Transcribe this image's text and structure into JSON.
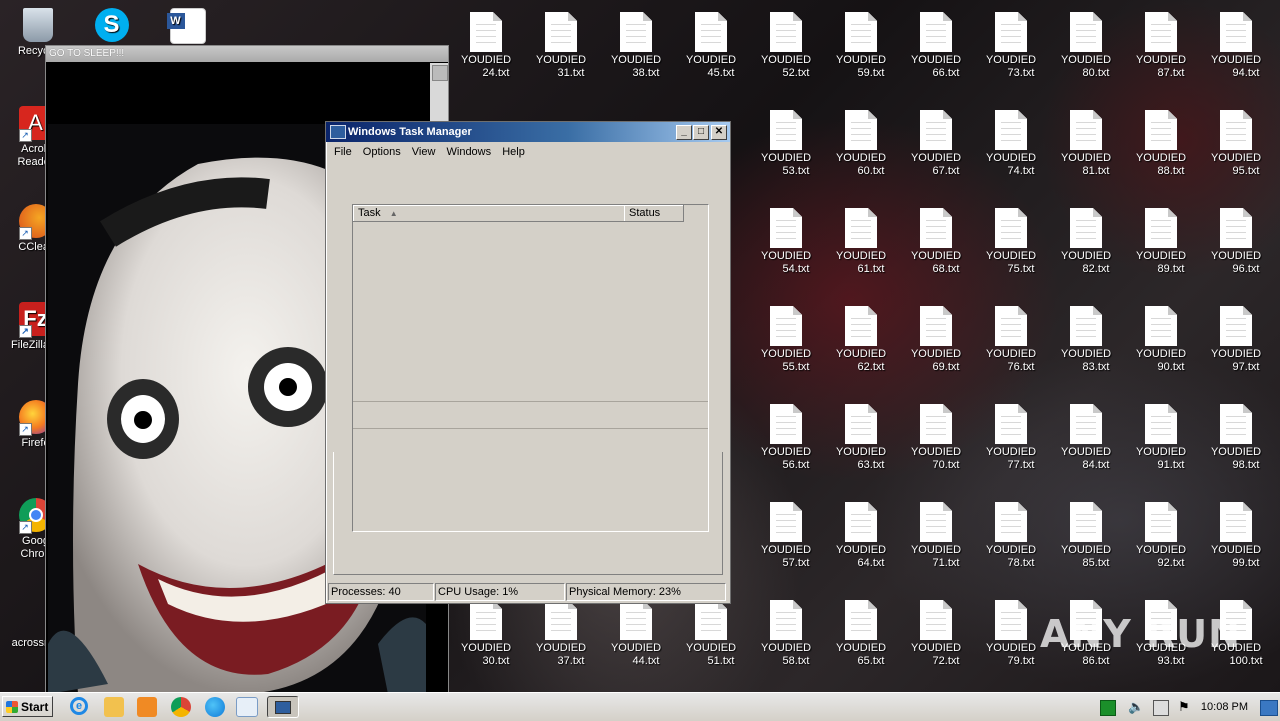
{
  "desktop_shortcuts": [
    {
      "label": "Recycle",
      "icon": "recycle-bin-icon",
      "color": "#9aa9b8"
    },
    {
      "label": "Acrob\nReader",
      "icon": "acrobat-icon",
      "color": "#d7261e"
    },
    {
      "label": "CClear",
      "icon": "ccleaner-icon",
      "color": "#e05a1b"
    },
    {
      "label": "FileZilla C",
      "icon": "filezilla-icon",
      "color": "#c8201d"
    },
    {
      "label": "Firefo",
      "icon": "firefox-icon",
      "color": "#f47b20"
    },
    {
      "label": "Goog\nChron",
      "icon": "chrome-icon",
      "color": "#34a853"
    },
    {
      "label": "acrossma",
      "icon": "file-icon",
      "color": "#ffffff"
    }
  ],
  "top_icons": [
    {
      "label": "",
      "icon": "skype-icon",
      "color": "#00aff0"
    },
    {
      "label": "",
      "icon": "word-icon",
      "color": "#2b579a"
    }
  ],
  "files": [
    {
      "line1": "YOUDIED",
      "line2": "24.txt"
    },
    {
      "line1": "YOUDIED",
      "line2": "31.txt"
    },
    {
      "line1": "YOUDIED",
      "line2": "38.txt"
    },
    {
      "line1": "YOUDIED",
      "line2": "45.txt"
    },
    {
      "line1": "YOUDIED",
      "line2": "52.txt"
    },
    {
      "line1": "YOUDIED",
      "line2": "59.txt"
    },
    {
      "line1": "YOUDIED",
      "line2": "66.txt"
    },
    {
      "line1": "YOUDIED",
      "line2": "73.txt"
    },
    {
      "line1": "YOUDIED",
      "line2": "80.txt"
    },
    {
      "line1": "YOUDIED",
      "line2": "87.txt"
    },
    {
      "line1": "YOUDIED",
      "line2": "94.txt"
    },
    {
      "line1": "YOUDIED",
      "line2": "53.txt"
    },
    {
      "line1": "YOUDIED",
      "line2": "60.txt"
    },
    {
      "line1": "YOUDIED",
      "line2": "67.txt"
    },
    {
      "line1": "YOUDIED",
      "line2": "74.txt"
    },
    {
      "line1": "YOUDIED",
      "line2": "81.txt"
    },
    {
      "line1": "YOUDIED",
      "line2": "88.txt"
    },
    {
      "line1": "YOUDIED",
      "line2": "95.txt"
    },
    {
      "line1": "YOUDIED",
      "line2": "54.txt"
    },
    {
      "line1": "YOUDIED",
      "line2": "61.txt"
    },
    {
      "line1": "YOUDIED",
      "line2": "68.txt"
    },
    {
      "line1": "YOUDIED",
      "line2": "75.txt"
    },
    {
      "line1": "YOUDIED",
      "line2": "82.txt"
    },
    {
      "line1": "YOUDIED",
      "line2": "89.txt"
    },
    {
      "line1": "YOUDIED",
      "line2": "96.txt"
    },
    {
      "line1": "YOUDIED",
      "line2": "55.txt"
    },
    {
      "line1": "YOUDIED",
      "line2": "62.txt"
    },
    {
      "line1": "YOUDIED",
      "line2": "69.txt"
    },
    {
      "line1": "YOUDIED",
      "line2": "76.txt"
    },
    {
      "line1": "YOUDIED",
      "line2": "83.txt"
    },
    {
      "line1": "YOUDIED",
      "line2": "90.txt"
    },
    {
      "line1": "YOUDIED",
      "line2": "97.txt"
    },
    {
      "line1": "YOUDIED",
      "line2": "56.txt"
    },
    {
      "line1": "YOUDIED",
      "line2": "63.txt"
    },
    {
      "line1": "YOUDIED",
      "line2": "70.txt"
    },
    {
      "line1": "YOUDIED",
      "line2": "77.txt"
    },
    {
      "line1": "YOUDIED",
      "line2": "84.txt"
    },
    {
      "line1": "YOUDIED",
      "line2": "91.txt"
    },
    {
      "line1": "YOUDIED",
      "line2": "98.txt"
    },
    {
      "line1": "YOUDIED",
      "line2": "57.txt"
    },
    {
      "line1": "YOUDIED",
      "line2": "64.txt"
    },
    {
      "line1": "YOUDIED",
      "line2": "71.txt"
    },
    {
      "line1": "YOUDIED",
      "line2": "78.txt"
    },
    {
      "line1": "YOUDIED",
      "line2": "85.txt"
    },
    {
      "line1": "YOUDIED",
      "line2": "92.txt"
    },
    {
      "line1": "YOUDIED",
      "line2": "99.txt"
    },
    {
      "line1": "YOUDIED",
      "line2": "30.txt"
    },
    {
      "line1": "YOUDIED",
      "line2": "37.txt"
    },
    {
      "line1": "YOUDIED",
      "line2": "44.txt"
    },
    {
      "line1": "YOUDIED",
      "line2": "51.txt"
    },
    {
      "line1": "YOUDIED",
      "line2": "58.txt"
    },
    {
      "line1": "YOUDIED",
      "line2": "65.txt"
    },
    {
      "line1": "YOUDIED",
      "line2": "72.txt"
    },
    {
      "line1": "YOUDIED",
      "line2": "79.txt"
    },
    {
      "line1": "YOUDIED",
      "line2": "86.txt"
    },
    {
      "line1": "YOUDIED",
      "line2": "93.txt"
    },
    {
      "line1": "YOUDIED",
      "line2": "100.txt"
    }
  ],
  "horror_window": {
    "title": "GO TO SLEEP!!!"
  },
  "task_manager": {
    "title": "Windows Task Manager",
    "menu": [
      "File",
      "Options",
      "View",
      "Windows",
      "Help"
    ],
    "columns": {
      "task": "Task",
      "status": "Status"
    },
    "status_bar": {
      "processes": "Processes: 40",
      "cpu": "CPU Usage: 1%",
      "memory": "Physical Memory: 23%"
    },
    "controls": {
      "minimize": "_",
      "maximize": "□",
      "close": "✕"
    }
  },
  "taskbar": {
    "start_label": "Start",
    "clock": "10:08 PM",
    "pinned": [
      {
        "icon": "ie-icon",
        "color": "#1e88e5"
      },
      {
        "icon": "explorer-icon",
        "color": "#f2c14e"
      },
      {
        "icon": "media-player-icon",
        "color": "#f08a24"
      },
      {
        "icon": "chrome-icon",
        "color": "#db4437"
      },
      {
        "icon": "edge-icon",
        "color": "#0f7ad8"
      },
      {
        "icon": "notepad-icon",
        "color": "#a7c7e7"
      },
      {
        "icon": "task-manager-icon",
        "color": "#5a7fa8"
      }
    ]
  },
  "watermark": "ANY RUN"
}
